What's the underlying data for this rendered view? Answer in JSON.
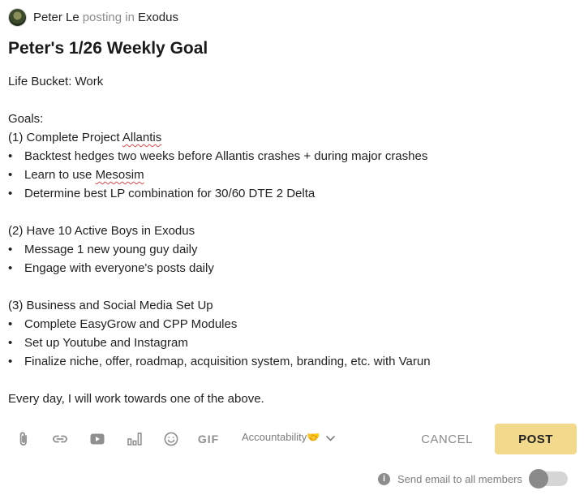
{
  "header": {
    "author": "Peter Le",
    "posting_text": "posting in",
    "group": "Exodus"
  },
  "post": {
    "title": "Peter's 1/26 Weekly Goal",
    "life_bucket": "Life Bucket: Work",
    "goals_heading": "Goals:",
    "goal1": {
      "prefix": "(1) Complete Project ",
      "project": "Allantis",
      "bullets": [
        "Backtest hedges two weeks before Allantis crashes + during major crashes",
        "Learn to use ",
        "Determine best LP combination for 30/60 DTE 2 Delta"
      ],
      "mesosim": "Mesosim"
    },
    "goal2": {
      "heading": "(2) Have 10 Active Boys in Exodus",
      "bullets": [
        "Message 1 new young guy daily",
        "Engage with everyone's posts daily"
      ]
    },
    "goal3": {
      "heading": "(3) Business and Social Media Set Up",
      "bullets": [
        "Complete EasyGrow and CPP Modules",
        "Set up Youtube and Instagram",
        "Finalize niche, offer, roadmap, acquisition system, branding, etc. with Varun"
      ]
    },
    "closing": "Every day, I will work towards one of the above.",
    "bullet_char": "•"
  },
  "toolbar": {
    "icons": [
      "attachment-icon",
      "link-icon",
      "youtube-icon",
      "poll-icon",
      "emoji-icon",
      "gif-icon"
    ],
    "gif_label": "GIF",
    "category": "Accountability🤝",
    "cancel_label": "CANCEL",
    "post_label": "POST"
  },
  "email": {
    "info_glyph": "i",
    "label": "Send email to all members",
    "enabled": false
  },
  "colors": {
    "post_button": "#f3d98b",
    "spell_underline": "#e04848",
    "muted": "#8f8f8f"
  }
}
